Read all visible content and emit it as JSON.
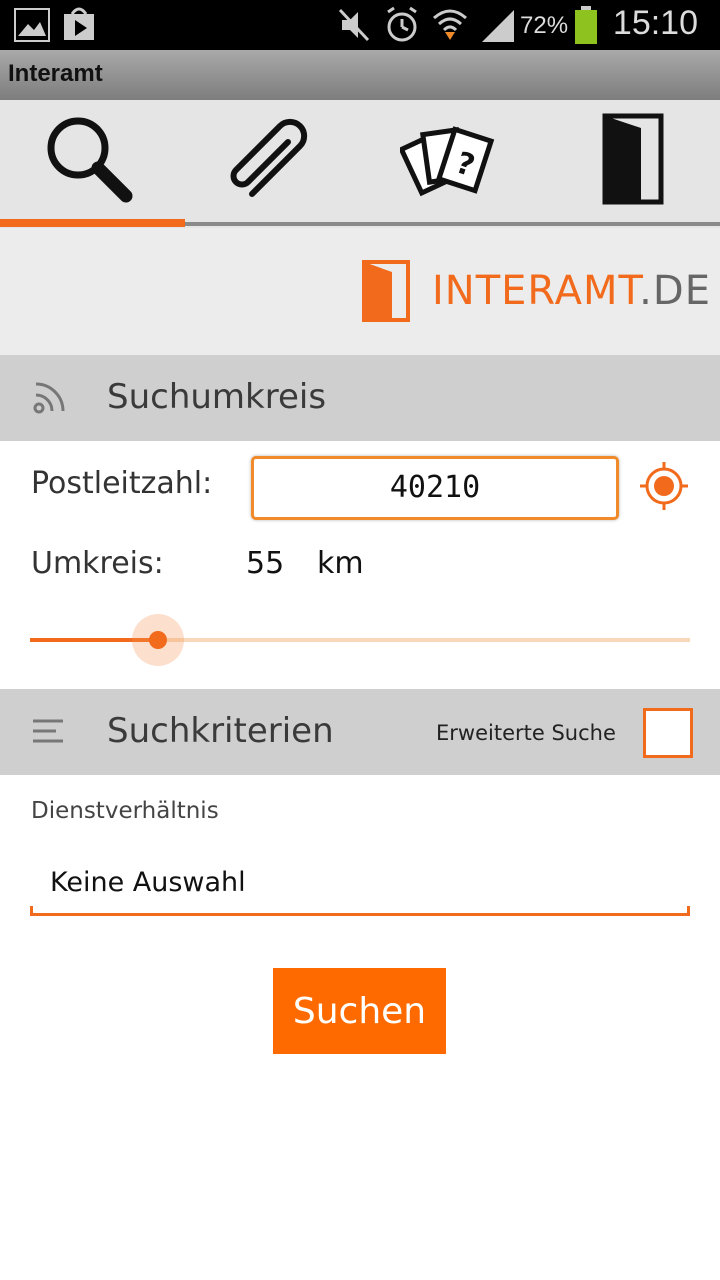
{
  "status_bar": {
    "battery_percent": "72%",
    "time": "15:10",
    "icons": [
      "gallery-icon",
      "play-store-icon",
      "mute-icon",
      "alarm-icon",
      "wifi-icon",
      "signal-icon",
      "battery-icon"
    ]
  },
  "app": {
    "title": "Interamt"
  },
  "tabs": [
    {
      "icon": "search-icon",
      "active": true
    },
    {
      "icon": "paperclip-icon",
      "active": false
    },
    {
      "icon": "cards-question-icon",
      "active": false
    },
    {
      "icon": "door-exit-icon",
      "active": false
    }
  ],
  "logo": {
    "main": "INTERAMT",
    "suffix": ".DE"
  },
  "search_radius": {
    "heading": "Suchumkreis",
    "zip_label": "Postleitzahl:",
    "zip_value": "40210",
    "radius_label": "Umkreis:",
    "radius_value": "55",
    "radius_unit": "km",
    "slider_fraction": 0.19
  },
  "criteria": {
    "heading": "Suchkriterien",
    "extended_label": "Erweiterte Suche",
    "extended_checked": false,
    "field_label": "Dienstverhältnis",
    "field_value": "Keine Auswahl"
  },
  "search_button": {
    "label": "Suchen"
  },
  "colors": {
    "accent": "#f26a1b",
    "button": "#ff6a00",
    "section_bg": "#cfcfcf",
    "logo_gray": "#666666"
  }
}
